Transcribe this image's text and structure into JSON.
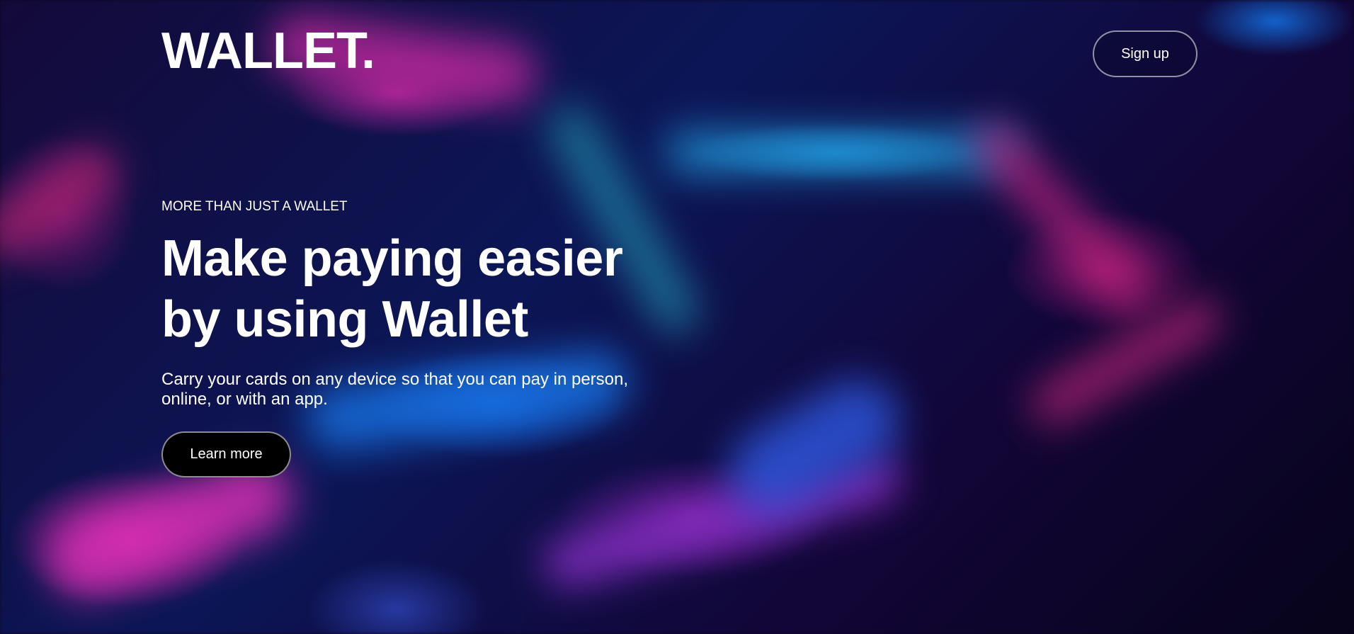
{
  "header": {
    "logo_text": "WALLET.",
    "signup_label": "Sign up"
  },
  "hero": {
    "eyebrow": "MORE THAN JUST A WALLET",
    "headline_line1": "Make paying easier",
    "headline_line2": "by using Wallet",
    "subtext_line1": "Carry your cards on any device so that you can pay in person,",
    "subtext_line2": "online, or with an app.",
    "cta_label": "Learn more"
  },
  "colors": {
    "text": "#ffffff",
    "cta_background": "#000000",
    "background_dark": "#0a0620",
    "accent_magenta": "#d52fb2",
    "accent_blue": "#1f8fd0"
  }
}
